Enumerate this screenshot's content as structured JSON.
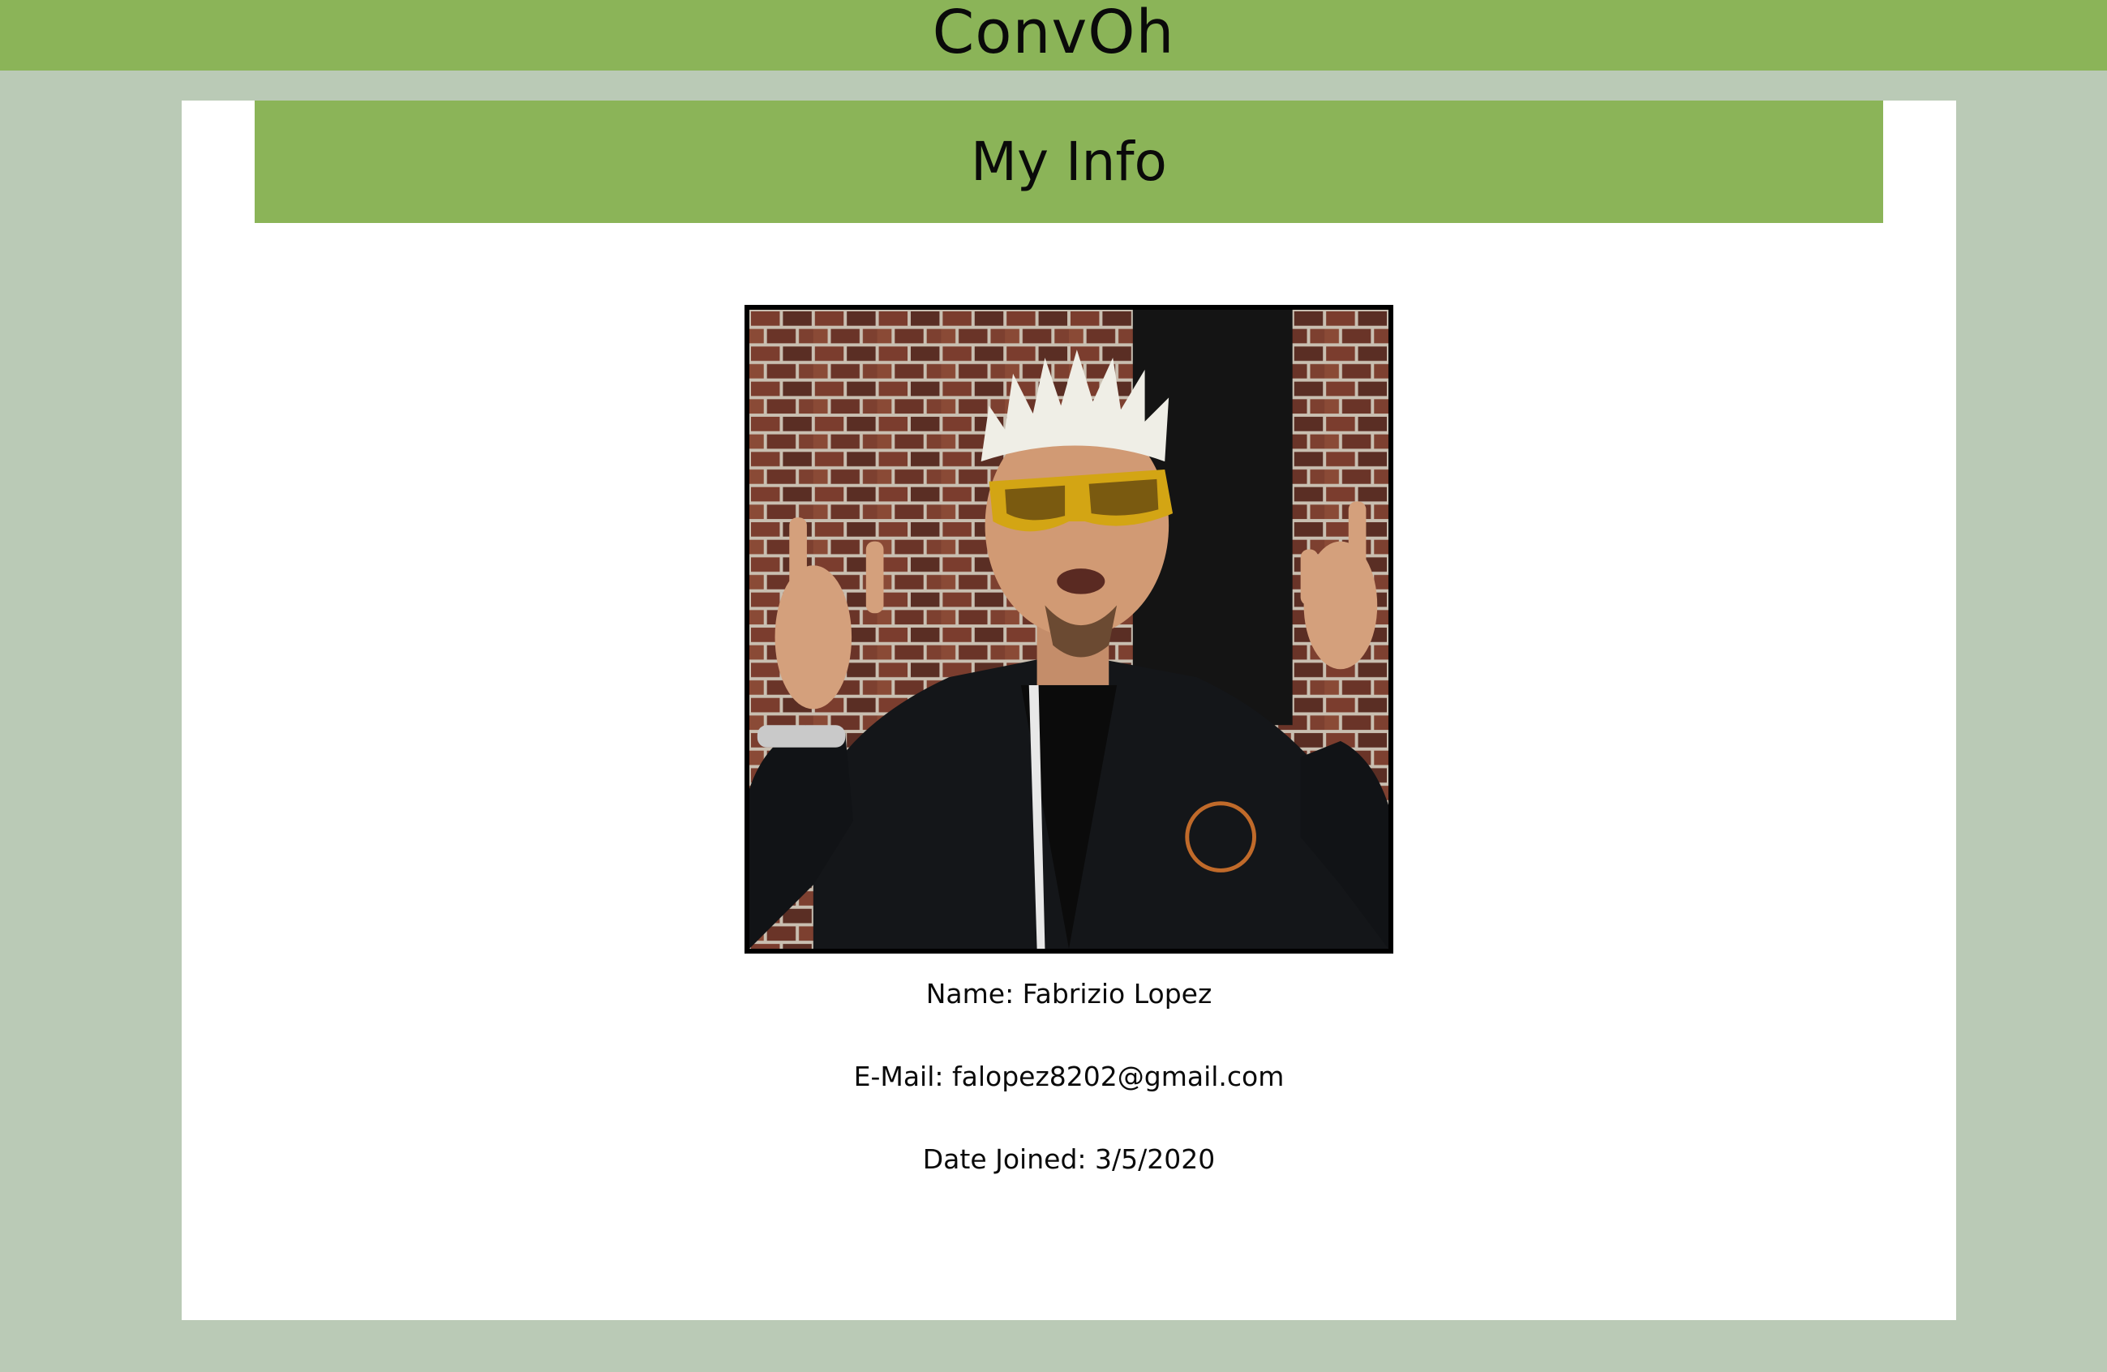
{
  "header": {
    "app_title": "ConvOh"
  },
  "profile": {
    "section_title": "My Info",
    "photo_icon": "profile-photo",
    "name_line": "Name: Fabrizio Lopez",
    "email_line": "E-Mail: falopez8202@gmail.com",
    "date_line": "Date Joined: 3/5/2020"
  },
  "colors": {
    "page_background": "#bacab6",
    "accent_green": "#8bb458",
    "card_background": "#ffffff",
    "text": "#0a0a0a"
  }
}
